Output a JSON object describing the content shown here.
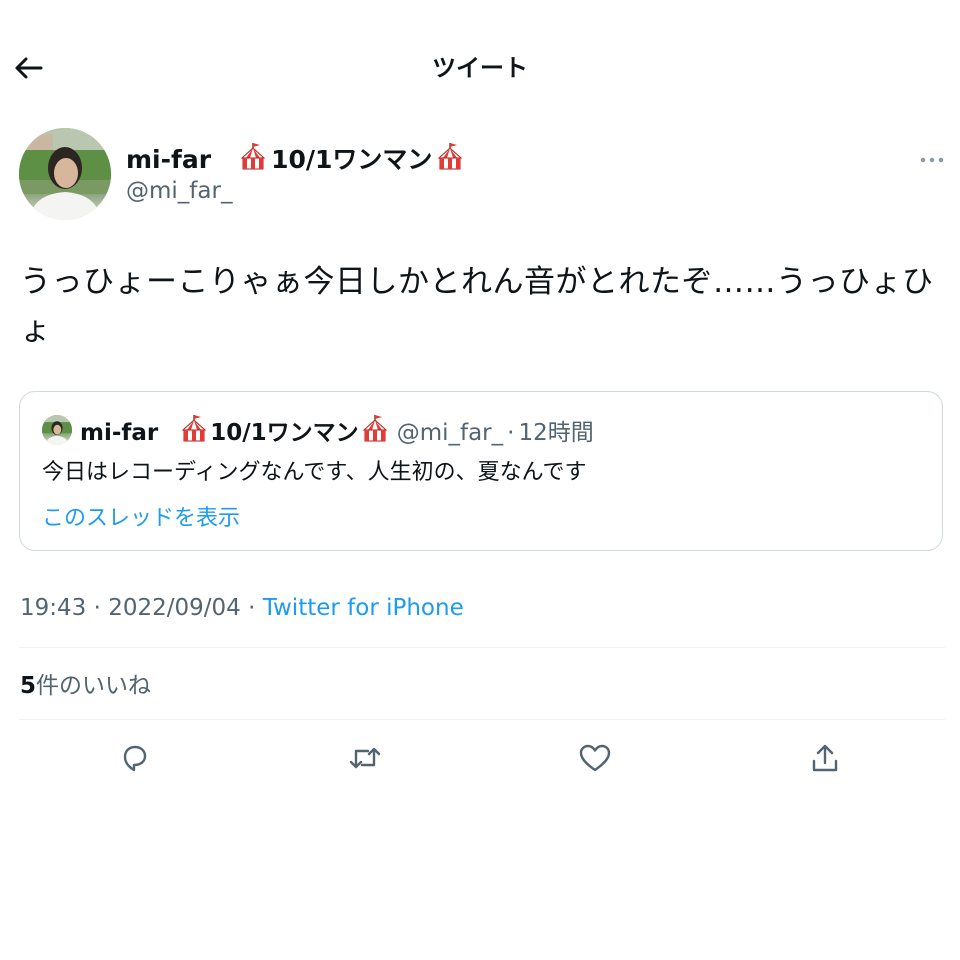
{
  "header": {
    "title": "ツイート"
  },
  "author": {
    "name": "mi-far",
    "name_suffix": "10/1ワンマン",
    "handle": "@mi_far_"
  },
  "tweet": {
    "text": "うっひょーこりゃぁ今日しかとれん音がとれたぞ……うっひょひょ"
  },
  "quote": {
    "name": "mi-far",
    "name_suffix": "10/1ワンマン",
    "handle": "@mi_far_",
    "separator": "·",
    "time": "12時間",
    "text": "今日はレコーディングなんです、人生初の、夏なんです",
    "show_thread": "このスレッドを表示"
  },
  "meta": {
    "time": "19:43",
    "separator": "·",
    "date": "2022/09/04",
    "source": "Twitter for iPhone"
  },
  "stats": {
    "likes_count": "5",
    "likes_label": "件のいいね"
  },
  "icons": {
    "back": "arrow-left-icon",
    "more": "more-icon",
    "tent": "circus-tent-icon",
    "reply": "reply-icon",
    "retweet": "retweet-icon",
    "like": "heart-icon",
    "share": "share-icon"
  },
  "colors": {
    "accent": "#1d9bf0",
    "text": "#0f1419",
    "secondary": "#536471",
    "border": "#cfd9de"
  }
}
